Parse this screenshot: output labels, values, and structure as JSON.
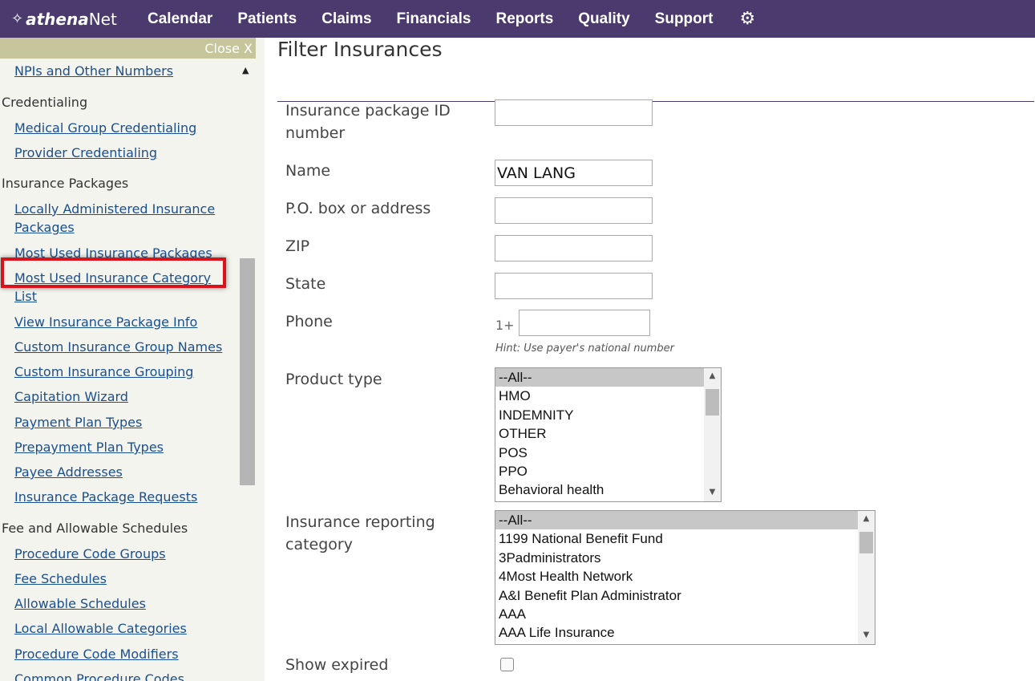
{
  "topnav": {
    "logo_mark": "✧",
    "logo_a": "athena",
    "logo_b": "Net",
    "items": [
      "Calendar",
      "Patients",
      "Claims",
      "Financials",
      "Reports",
      "Quality",
      "Support"
    ],
    "settings_icon": "gear-icon"
  },
  "sidebar": {
    "close_label": "Close X",
    "items": [
      {
        "type": "link",
        "label": "NPIs and Other Numbers"
      },
      {
        "type": "section",
        "label": "Credentialing"
      },
      {
        "type": "link",
        "label": "Medical Group Credentialing"
      },
      {
        "type": "link",
        "label": "Provider Credentialing"
      },
      {
        "type": "section",
        "label": "Insurance Packages"
      },
      {
        "type": "link",
        "label": "Locally Administered Insurance Packages"
      },
      {
        "type": "link",
        "label": "Most Used Insurance Packages"
      },
      {
        "type": "link",
        "label": "Most Used Insurance Category List"
      },
      {
        "type": "link",
        "label": "View Insurance Package Info"
      },
      {
        "type": "link",
        "label": "Custom Insurance Group Names"
      },
      {
        "type": "link",
        "label": "Custom Insurance Grouping"
      },
      {
        "type": "link",
        "label": "Capitation Wizard"
      },
      {
        "type": "link",
        "label": "Payment Plan Types"
      },
      {
        "type": "link",
        "label": "Prepayment Plan Types"
      },
      {
        "type": "link",
        "label": "Payee Addresses"
      },
      {
        "type": "link",
        "label": "Insurance Package Requests"
      },
      {
        "type": "section",
        "label": "Fee and Allowable Schedules"
      },
      {
        "type": "link",
        "label": "Procedure Code Groups"
      },
      {
        "type": "link",
        "label": "Fee Schedules"
      },
      {
        "type": "link",
        "label": "Allowable Schedules"
      },
      {
        "type": "link",
        "label": "Local Allowable Categories"
      },
      {
        "type": "link",
        "label": "Procedure Code Modifiers"
      },
      {
        "type": "link",
        "label": "Common Procedure Codes"
      }
    ],
    "highlight_color": "#d8131b"
  },
  "form": {
    "title": "Filter Insurances",
    "package_id": {
      "label": "Insurance package ID number",
      "value": ""
    },
    "name": {
      "label": "Name",
      "value": "VAN LANG"
    },
    "address": {
      "label": "P.O. box or address",
      "value": ""
    },
    "zip": {
      "label": "ZIP",
      "value": ""
    },
    "state": {
      "label": "State",
      "value": ""
    },
    "phone": {
      "label": "Phone",
      "prefix": "1+",
      "value": "",
      "hint": "Hint: Use payer's national number"
    },
    "product_type": {
      "label": "Product type",
      "options": [
        "--All--",
        "HMO",
        "INDEMNITY",
        "OTHER",
        "POS",
        "PPO",
        "Behavioral health"
      ],
      "selected": "--All--"
    },
    "reporting_category": {
      "label": "Insurance reporting category",
      "options": [
        "--All--",
        "1199 National Benefit Fund",
        "3Padministrators",
        "4Most Health Network",
        "A&I Benefit Plan Administrator",
        "AAA",
        "AAA Life Insurance"
      ],
      "selected": "--All--"
    },
    "show_expired": {
      "label": "Show expired",
      "checked": false
    }
  },
  "colors": {
    "nav_bg": "#4a3a6e",
    "link": "#1a4f8f",
    "sidebar_bg": "#f4f4ee",
    "close_strip": "#c6c59c"
  }
}
